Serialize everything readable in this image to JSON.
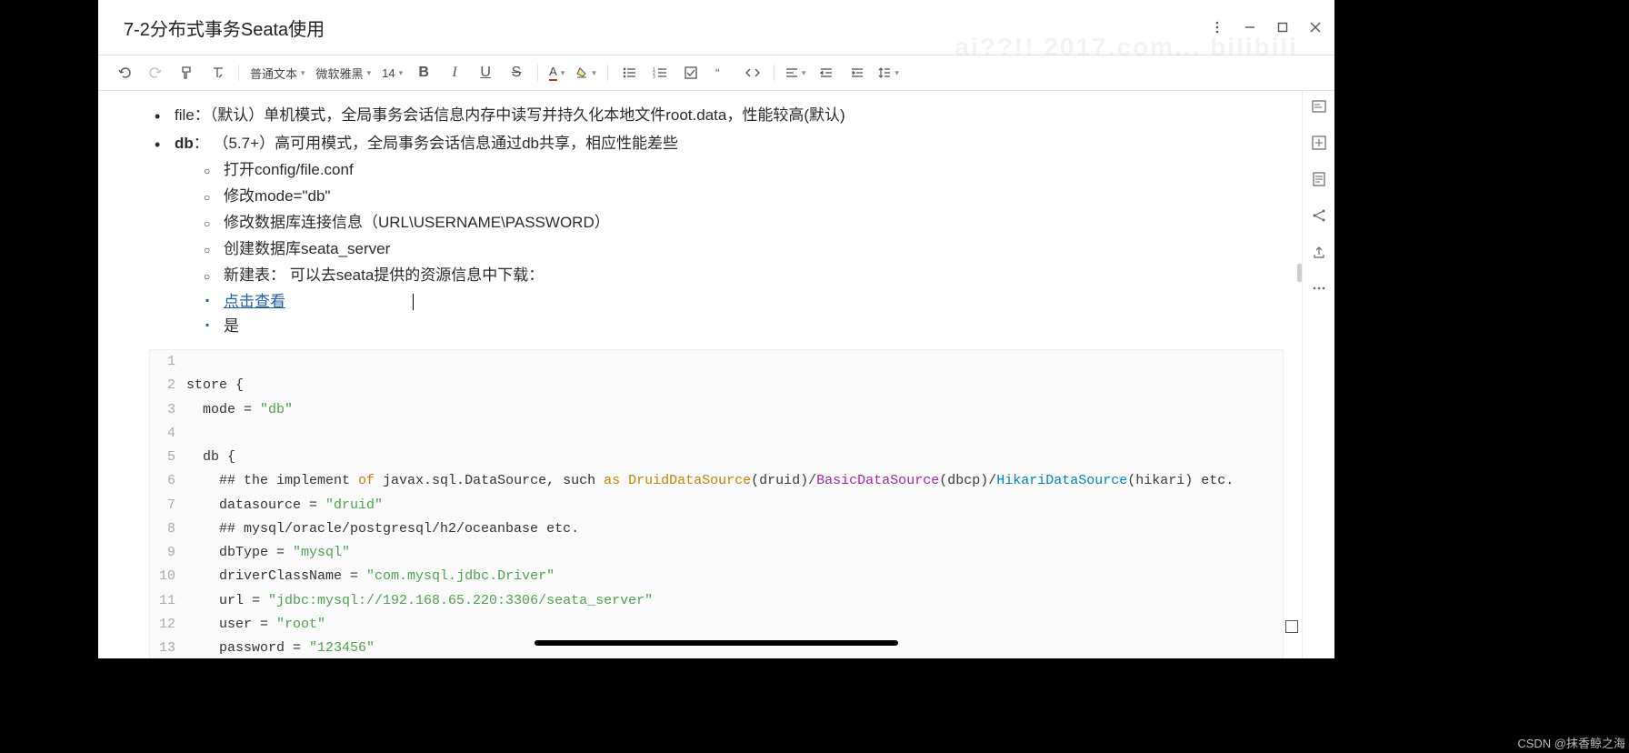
{
  "title": "7-2分布式事务Seata使用",
  "watermark": "ai??!! 2017.com... bilibili",
  "toolbar": {
    "paragraph_style": "普通文本",
    "font_family": "微软雅黑",
    "font_size": "14"
  },
  "body": {
    "li1_prefix": "file：",
    "li1_rest": "（默认）单机模式，全局事务会话信息内存中读写并持久化本地文件root.data，性能较高(默认)",
    "li2_bold": "db",
    "li2_rest": "：  （5.7+）高可用模式，全局事务会话信息通过db共享，相应性能差些",
    "sub1": "打开config/file.conf",
    "sub2": "修改mode=\"db\"",
    "sub3": "修改数据库连接信息（URL\\USERNAME\\PASSWORD）",
    "sub4": "创建数据库seata_server",
    "sub5": "新建表：  可以去seata提供的资源信息中下载：",
    "link": "点击查看",
    "sq2": "是"
  },
  "code": {
    "lines": [
      {
        "n": "1",
        "raw": ""
      },
      {
        "n": "2",
        "raw": "store {"
      },
      {
        "n": "3",
        "raw": "  mode = \"db\"",
        "str": "\"db\""
      },
      {
        "n": "4",
        "raw": ""
      },
      {
        "n": "5",
        "raw": "  db {"
      },
      {
        "n": "6",
        "raw": "    ## the implement of javax.sql.DataSource, such as DruidDataSource(druid)/BasicDataSource(dbcp)/HikariDataSource(hikari) etc."
      },
      {
        "n": "7",
        "raw": "    datasource = \"druid\"",
        "str": "\"druid\""
      },
      {
        "n": "8",
        "raw": "    ## mysql/oracle/postgresql/h2/oceanbase etc."
      },
      {
        "n": "9",
        "raw": "    dbType = \"mysql\"",
        "str": "\"mysql\""
      },
      {
        "n": "10",
        "raw": "    driverClassName = \"com.mysql.jdbc.Driver\"",
        "str": "\"com.mysql.jdbc.Driver\""
      },
      {
        "n": "11",
        "raw": "    url = \"jdbc:mysql://192.168.65.220:3306/seata_server\"",
        "str": "\"jdbc:mysql://192.168.65.220:3306/seata_server\""
      },
      {
        "n": "12",
        "raw": "    user = \"root\"",
        "str": "\"root\""
      },
      {
        "n": "13",
        "raw": "    password = \"123456\"",
        "str": "\"123456\""
      }
    ],
    "line6": {
      "prefix": "    ## the implement ",
      "of": "of",
      "mid1": " javax.sql.DataSource, such ",
      "as": "as",
      "sp": " ",
      "d1": "DruidDataSource",
      "p1": "(druid)/",
      "d2": "BasicDataSource",
      "p2": "(dbcp)/",
      "d3": "HikariDataSource",
      "p3": "(hikari)",
      "tail": " etc."
    }
  },
  "csdn": "CSDN @抹香鲸之海"
}
